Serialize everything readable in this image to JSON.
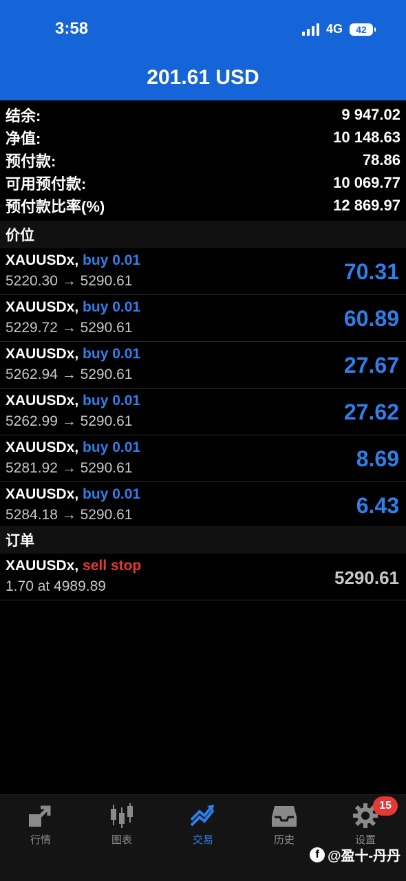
{
  "status": {
    "time": "3:58",
    "network": "4G",
    "battery": "42"
  },
  "header": {
    "title": "201.61 USD"
  },
  "summary": [
    {
      "label": "结余:",
      "value": "9 947.02"
    },
    {
      "label": "净值:",
      "value": "10 148.63"
    },
    {
      "label": "预付款:",
      "value": "78.86"
    },
    {
      "label": "可用预付款:",
      "value": "10 069.77"
    },
    {
      "label": "预付款比率(%)",
      "value": "12 869.97"
    }
  ],
  "sections": {
    "positions": "价位",
    "orders": "订单"
  },
  "positions": [
    {
      "symbol": "XAUUSDx,",
      "side": "buy 0.01",
      "prices": "5220.30 → 5290.61",
      "profit": "70.31"
    },
    {
      "symbol": "XAUUSDx,",
      "side": "buy 0.01",
      "prices": "5229.72 → 5290.61",
      "profit": "60.89"
    },
    {
      "symbol": "XAUUSDx,",
      "side": "buy 0.01",
      "prices": "5262.94 → 5290.61",
      "profit": "27.67"
    },
    {
      "symbol": "XAUUSDx,",
      "side": "buy 0.01",
      "prices": "5262.99 → 5290.61",
      "profit": "27.62"
    },
    {
      "symbol": "XAUUSDx,",
      "side": "buy 0.01",
      "prices": "5281.92 → 5290.61",
      "profit": "8.69"
    },
    {
      "symbol": "XAUUSDx,",
      "side": "buy 0.01",
      "prices": "5284.18 → 5290.61",
      "profit": "6.43"
    }
  ],
  "order": {
    "symbol": "XAUUSDx,",
    "side": "sell stop",
    "detail": "1.70 at 4989.89",
    "price": "5290.61"
  },
  "tabs": [
    {
      "label": "行情",
      "icon": "quotes-arrow-icon"
    },
    {
      "label": "图表",
      "icon": "candlestick-chart-icon"
    },
    {
      "label": "交易",
      "icon": "trade-trend-icon"
    },
    {
      "label": "历史",
      "icon": "history-inbox-icon"
    },
    {
      "label": "设置",
      "icon": "gear-icon"
    }
  ],
  "settings_badge": "15",
  "watermark": "@盈十-丹丹",
  "colors": {
    "header_blue": "#1565d8",
    "buy_blue": "#2f7fea",
    "sell_red": "#e53935",
    "background": "#000000"
  }
}
